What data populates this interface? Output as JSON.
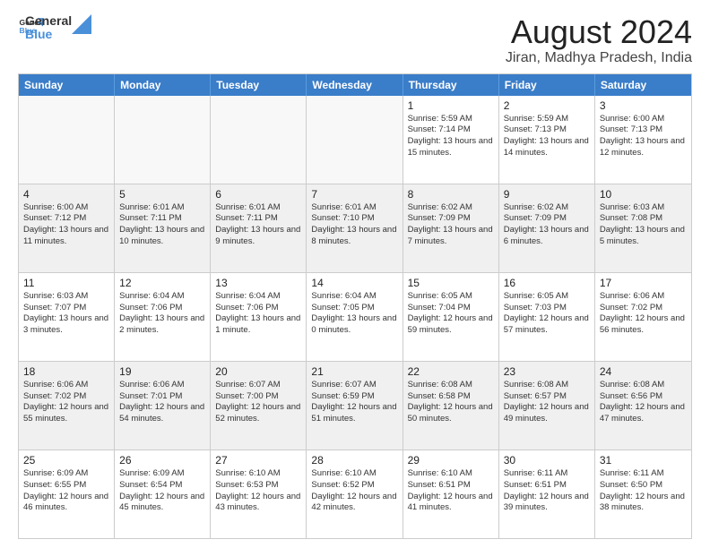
{
  "header": {
    "logo_general": "General",
    "logo_blue": "Blue",
    "title": "August 2024",
    "subtitle": "Jiran, Madhya Pradesh, India"
  },
  "calendar": {
    "weekdays": [
      "Sunday",
      "Monday",
      "Tuesday",
      "Wednesday",
      "Thursday",
      "Friday",
      "Saturday"
    ],
    "rows": [
      [
        {
          "day": "",
          "info": "",
          "empty": true
        },
        {
          "day": "",
          "info": "",
          "empty": true
        },
        {
          "day": "",
          "info": "",
          "empty": true
        },
        {
          "day": "",
          "info": "",
          "empty": true
        },
        {
          "day": "1",
          "info": "Sunrise: 5:59 AM\nSunset: 7:14 PM\nDaylight: 13 hours\nand 15 minutes."
        },
        {
          "day": "2",
          "info": "Sunrise: 5:59 AM\nSunset: 7:13 PM\nDaylight: 13 hours\nand 14 minutes."
        },
        {
          "day": "3",
          "info": "Sunrise: 6:00 AM\nSunset: 7:13 PM\nDaylight: 13 hours\nand 12 minutes."
        }
      ],
      [
        {
          "day": "4",
          "info": "Sunrise: 6:00 AM\nSunset: 7:12 PM\nDaylight: 13 hours\nand 11 minutes.",
          "shaded": true
        },
        {
          "day": "5",
          "info": "Sunrise: 6:01 AM\nSunset: 7:11 PM\nDaylight: 13 hours\nand 10 minutes.",
          "shaded": true
        },
        {
          "day": "6",
          "info": "Sunrise: 6:01 AM\nSunset: 7:11 PM\nDaylight: 13 hours\nand 9 minutes.",
          "shaded": true
        },
        {
          "day": "7",
          "info": "Sunrise: 6:01 AM\nSunset: 7:10 PM\nDaylight: 13 hours\nand 8 minutes.",
          "shaded": true
        },
        {
          "day": "8",
          "info": "Sunrise: 6:02 AM\nSunset: 7:09 PM\nDaylight: 13 hours\nand 7 minutes.",
          "shaded": true
        },
        {
          "day": "9",
          "info": "Sunrise: 6:02 AM\nSunset: 7:09 PM\nDaylight: 13 hours\nand 6 minutes.",
          "shaded": true
        },
        {
          "day": "10",
          "info": "Sunrise: 6:03 AM\nSunset: 7:08 PM\nDaylight: 13 hours\nand 5 minutes.",
          "shaded": true
        }
      ],
      [
        {
          "day": "11",
          "info": "Sunrise: 6:03 AM\nSunset: 7:07 PM\nDaylight: 13 hours\nand 3 minutes."
        },
        {
          "day": "12",
          "info": "Sunrise: 6:04 AM\nSunset: 7:06 PM\nDaylight: 13 hours\nand 2 minutes."
        },
        {
          "day": "13",
          "info": "Sunrise: 6:04 AM\nSunset: 7:06 PM\nDaylight: 13 hours\nand 1 minute."
        },
        {
          "day": "14",
          "info": "Sunrise: 6:04 AM\nSunset: 7:05 PM\nDaylight: 13 hours\nand 0 minutes."
        },
        {
          "day": "15",
          "info": "Sunrise: 6:05 AM\nSunset: 7:04 PM\nDaylight: 12 hours\nand 59 minutes."
        },
        {
          "day": "16",
          "info": "Sunrise: 6:05 AM\nSunset: 7:03 PM\nDaylight: 12 hours\nand 57 minutes."
        },
        {
          "day": "17",
          "info": "Sunrise: 6:06 AM\nSunset: 7:02 PM\nDaylight: 12 hours\nand 56 minutes."
        }
      ],
      [
        {
          "day": "18",
          "info": "Sunrise: 6:06 AM\nSunset: 7:02 PM\nDaylight: 12 hours\nand 55 minutes.",
          "shaded": true
        },
        {
          "day": "19",
          "info": "Sunrise: 6:06 AM\nSunset: 7:01 PM\nDaylight: 12 hours\nand 54 minutes.",
          "shaded": true
        },
        {
          "day": "20",
          "info": "Sunrise: 6:07 AM\nSunset: 7:00 PM\nDaylight: 12 hours\nand 52 minutes.",
          "shaded": true
        },
        {
          "day": "21",
          "info": "Sunrise: 6:07 AM\nSunset: 6:59 PM\nDaylight: 12 hours\nand 51 minutes.",
          "shaded": true
        },
        {
          "day": "22",
          "info": "Sunrise: 6:08 AM\nSunset: 6:58 PM\nDaylight: 12 hours\nand 50 minutes.",
          "shaded": true
        },
        {
          "day": "23",
          "info": "Sunrise: 6:08 AM\nSunset: 6:57 PM\nDaylight: 12 hours\nand 49 minutes.",
          "shaded": true
        },
        {
          "day": "24",
          "info": "Sunrise: 6:08 AM\nSunset: 6:56 PM\nDaylight: 12 hours\nand 47 minutes.",
          "shaded": true
        }
      ],
      [
        {
          "day": "25",
          "info": "Sunrise: 6:09 AM\nSunset: 6:55 PM\nDaylight: 12 hours\nand 46 minutes."
        },
        {
          "day": "26",
          "info": "Sunrise: 6:09 AM\nSunset: 6:54 PM\nDaylight: 12 hours\nand 45 minutes."
        },
        {
          "day": "27",
          "info": "Sunrise: 6:10 AM\nSunset: 6:53 PM\nDaylight: 12 hours\nand 43 minutes."
        },
        {
          "day": "28",
          "info": "Sunrise: 6:10 AM\nSunset: 6:52 PM\nDaylight: 12 hours\nand 42 minutes."
        },
        {
          "day": "29",
          "info": "Sunrise: 6:10 AM\nSunset: 6:51 PM\nDaylight: 12 hours\nand 41 minutes."
        },
        {
          "day": "30",
          "info": "Sunrise: 6:11 AM\nSunset: 6:51 PM\nDaylight: 12 hours\nand 39 minutes."
        },
        {
          "day": "31",
          "info": "Sunrise: 6:11 AM\nSunset: 6:50 PM\nDaylight: 12 hours\nand 38 minutes."
        }
      ]
    ]
  }
}
